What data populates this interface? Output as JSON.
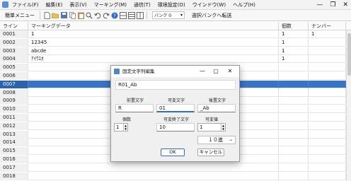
{
  "menu": {
    "items": [
      "ファイル(F)",
      "編集(E)",
      "表示(V)",
      "マーキング(M)",
      "通信(T)",
      "環境設定(O)",
      "ウインドウ(W)",
      "ヘルプ(H)"
    ],
    "window_controls": [
      "—",
      "❐",
      "✕"
    ]
  },
  "toolbar": {
    "simple_menu_label": "簡単メニュー",
    "bank_select": "バンク 0",
    "bank_transfer_label": "選択バンクへ転送"
  },
  "grid": {
    "headers": {
      "line": "ライン",
      "marking": "マーキングデータ",
      "count": "個数",
      "number": "ナンバー"
    },
    "rows": [
      {
        "line": "0001",
        "data": "1",
        "count": "1",
        "number": "1"
      },
      {
        "line": "0002",
        "data": "12345",
        "count": "1",
        "number": ""
      },
      {
        "line": "0003",
        "data": "abcde",
        "count": "1",
        "number": ""
      },
      {
        "line": "0004",
        "data": "ｱｲｳｴｵ",
        "count": "1",
        "number": ""
      },
      {
        "line": "0005",
        "data": "",
        "count": "",
        "number": ""
      },
      {
        "line": "0006",
        "data": "",
        "count": "",
        "number": ""
      },
      {
        "line": "0007",
        "data": "",
        "count": "",
        "number": ""
      },
      {
        "line": "0008",
        "data": "",
        "count": "",
        "number": ""
      },
      {
        "line": "0009",
        "data": "",
        "count": "",
        "number": ""
      },
      {
        "line": "0010",
        "data": "",
        "count": "",
        "number": ""
      },
      {
        "line": "0011",
        "data": "",
        "count": "",
        "number": ""
      },
      {
        "line": "0012",
        "data": "",
        "count": "",
        "number": ""
      },
      {
        "line": "0013",
        "data": "",
        "count": "",
        "number": ""
      },
      {
        "line": "0014",
        "data": "",
        "count": "",
        "number": ""
      },
      {
        "line": "0015",
        "data": "",
        "count": "",
        "number": ""
      },
      {
        "line": "0016",
        "data": "",
        "count": "",
        "number": ""
      },
      {
        "line": "0017",
        "data": "",
        "count": "",
        "number": ""
      },
      {
        "line": "0018",
        "data": "",
        "count": "",
        "number": ""
      }
    ],
    "selected_line": "0007"
  },
  "dialog": {
    "title": "固定文字列編集",
    "preview": "R01_Ab",
    "prefix_label": "前置文字",
    "prefix_value": "R",
    "variable_label": "可変文字",
    "variable_value": "01",
    "suffix_label": "後置文字",
    "suffix_value": "_Ab",
    "count_label": "個数",
    "count_value": "1",
    "var_end_label": "可変終了文字",
    "var_end_value": "10",
    "var_value_label": "可変値",
    "var_value_value": "1",
    "radix_value": "１０進",
    "ok_label": "OK",
    "cancel_label": "キャンセル"
  },
  "colors": {
    "selection": "#3a74c4",
    "accent": "#2d6fd1"
  }
}
